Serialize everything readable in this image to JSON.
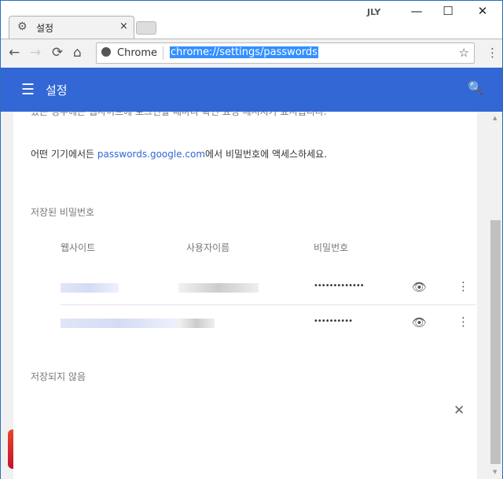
{
  "window": {
    "user_badge": "JLY",
    "minimize": "—",
    "maximize": "☐",
    "close": "✕"
  },
  "tab": {
    "title": "설정",
    "close": "×"
  },
  "toolbar": {
    "back": "←",
    "forward": "→",
    "reload": "⟳",
    "home": "⌂",
    "site_label": "Chrome",
    "url": "chrome://settings/passwords",
    "star": "☆",
    "menu": "⋮"
  },
  "header": {
    "title": "설정",
    "menu_icon": "☰",
    "search_icon": "🔍"
  },
  "content": {
    "cut_text": "있는 경우에는 웹사이트에 로그인할 때마다 확인 요청 메시지가 표시됩니다.",
    "access_prefix": "어떤 기기에서든 ",
    "access_link": "passwords.google.com",
    "access_suffix": "에서 비밀번호에 액세스하세요.",
    "saved_title": "저장된 비밀번호",
    "columns": [
      "웹사이트",
      "사용자이름",
      "비밀번호"
    ],
    "rows": [
      {
        "password": "•••••••••••••"
      },
      {
        "password": "••••••••••"
      }
    ],
    "never_saved_title": "저장되지 않음"
  },
  "colors": {
    "accent": "#3367d6",
    "link": "#3367d6"
  }
}
